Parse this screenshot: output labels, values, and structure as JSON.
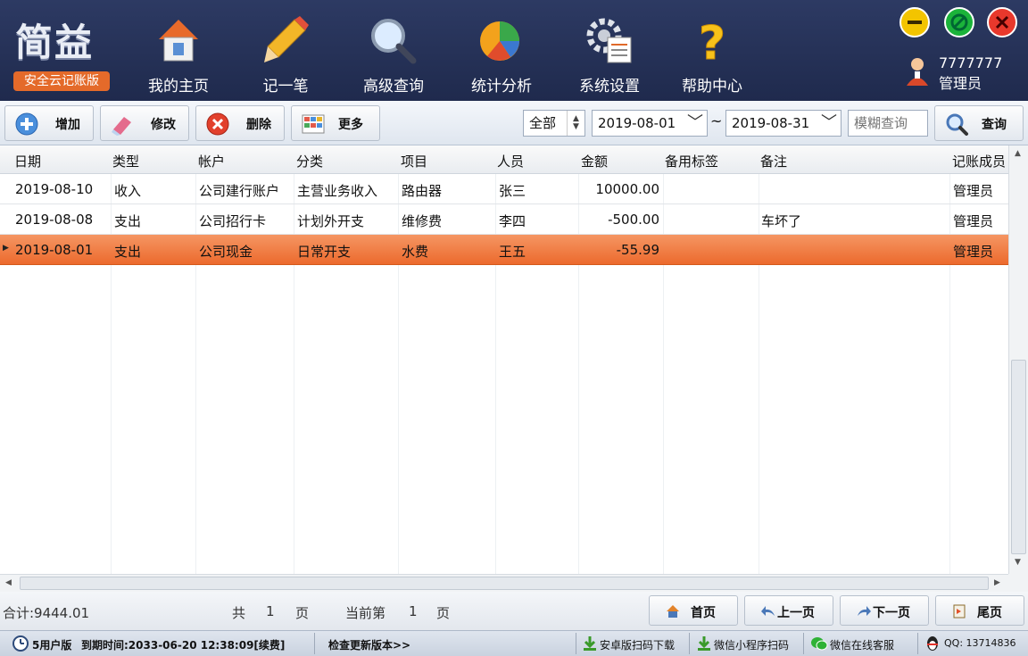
{
  "app": {
    "logo_text": "简益",
    "logo_badge": "安全云记账版"
  },
  "nav": [
    {
      "label": "我的主页",
      "icon": "home-icon"
    },
    {
      "label": "记一笔",
      "icon": "pencil-icon"
    },
    {
      "label": "高级查询",
      "icon": "magnifier-icon"
    },
    {
      "label": "统计分析",
      "icon": "pie-chart-icon"
    },
    {
      "label": "系统设置",
      "icon": "settings-gear-icon"
    },
    {
      "label": "帮助中心",
      "icon": "question-icon"
    }
  ],
  "user": {
    "name": "7777777",
    "role": "管理员"
  },
  "window": {
    "minimize_color": "#f3c400",
    "maximize_color": "#1bb33a",
    "close_color": "#e8382c"
  },
  "toolbar": {
    "add_label": "增加",
    "edit_label": "修改",
    "delete_label": "删除",
    "more_label": "更多",
    "type_filter": "全部",
    "date_from": "2019-08-01",
    "date_sep": "~",
    "date_to": "2019-08-31",
    "search_placeholder": "模糊查询",
    "query_label": "查询"
  },
  "table": {
    "headers": [
      "日期",
      "类型",
      "帐户",
      "分类",
      "项目",
      "人员",
      "金额",
      "备用标签",
      "备注",
      "记账成员"
    ],
    "rows": [
      {
        "date": "2019-08-10",
        "type": "收入",
        "account": "公司建行账户",
        "category": "主营业务收入",
        "project": "路由器",
        "person": "张三",
        "amount": "10000.00",
        "tag": "",
        "note": "",
        "member": "管理员"
      },
      {
        "date": "2019-08-08",
        "type": "支出",
        "account": "公司招行卡",
        "category": "计划外开支",
        "project": "维修费",
        "person": "李四",
        "amount": "-500.00",
        "tag": "",
        "note": "车坏了",
        "member": "管理员"
      },
      {
        "date": "2019-08-01",
        "type": "支出",
        "account": "公司现金",
        "category": "日常开支",
        "project": "水费",
        "person": "王五",
        "amount": "-55.99",
        "tag": "",
        "note": "",
        "member": "管理员"
      }
    ],
    "selected_row_color": "#ee7034"
  },
  "footer": {
    "total": "合计:9444.01",
    "total_pages_prefix": "共",
    "total_pages": "1",
    "pages_suffix": "页",
    "current_prefix": "当前第",
    "current_page": "1",
    "current_suffix": "页",
    "first": "首页",
    "prev": "上一页",
    "next": "下一页",
    "last": "尾页"
  },
  "status": {
    "edition": "5用户版",
    "expiry": "到期时间:2033-06-20 12:38:09[续费]",
    "check_update": "检查更新版本>>",
    "android": "安卓版扫码下载",
    "wechat_mini": "微信小程序扫码",
    "wechat_service": "微信在线客服",
    "qq": "QQ: 13714836"
  }
}
